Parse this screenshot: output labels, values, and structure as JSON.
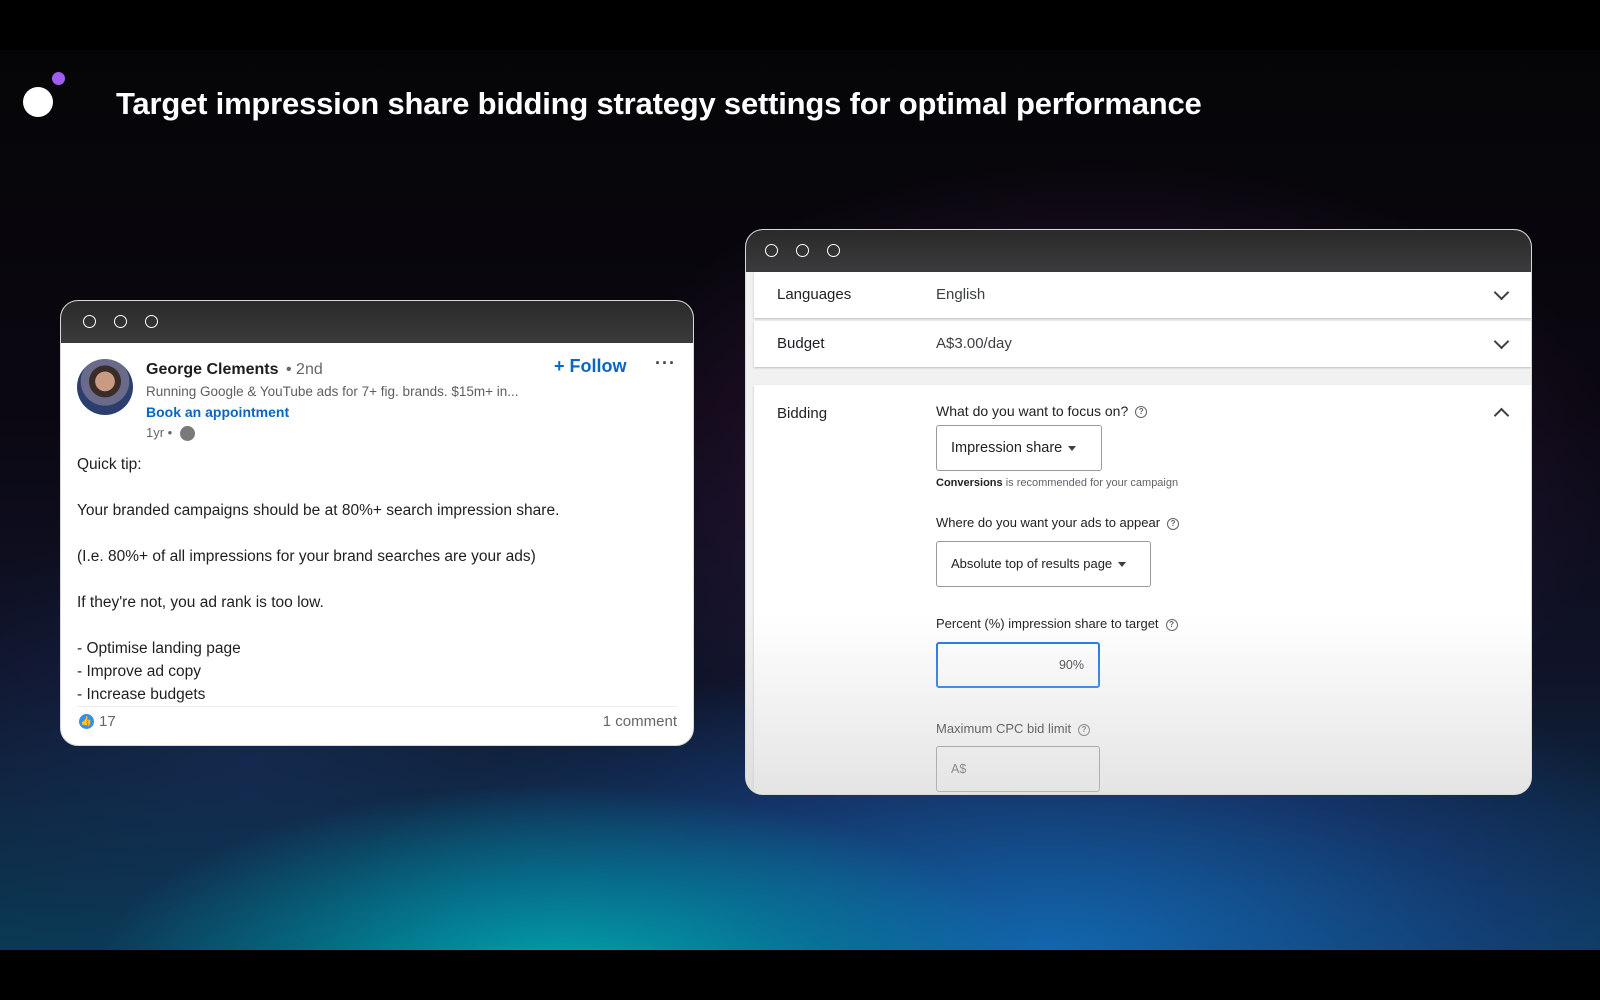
{
  "slide": {
    "title": "Target impression share bidding strategy settings for optimal performance",
    "accent_color": "#a35cf0"
  },
  "linkedin_post": {
    "author_name": "George Clements",
    "connection_degree": "• 2nd",
    "headline": "Running Google & YouTube ads for 7+ fig. brands. $15m+ in...",
    "appointment_link": "Book an appointment",
    "posted_ago": "1yr •",
    "follow_label": "+ Follow",
    "more_label": "···",
    "body_lines": [
      "Quick tip:",
      "",
      "Your branded campaigns should be at 80%+ search impression share.",
      "",
      "(I.e. 80%+ of all impressions for your brand searches are your ads)",
      "",
      "If they're not, you ad rank is too low.",
      "",
      "- Optimise landing page",
      "- Improve ad copy",
      "- Increase budgets"
    ],
    "reaction_count": "17",
    "comments_label": "1 comment"
  },
  "google_ads": {
    "languages": {
      "label": "Languages",
      "value": "English"
    },
    "budget": {
      "label": "Budget",
      "value": "A$3.00/day"
    },
    "bidding": {
      "label": "Bidding",
      "focus_question": "What do you want to focus on?",
      "focus_selected": "Impression share",
      "recommendation_strong": "Conversions",
      "recommendation_rest": " is recommended for your campaign",
      "placement_question": "Where do you want your ads to appear",
      "placement_selected": "Absolute top of results page",
      "percent_question": "Percent (%) impression share to target",
      "percent_value": "90%",
      "max_cpc_question": "Maximum CPC bid limit",
      "max_cpc_prefix": "A$"
    }
  }
}
